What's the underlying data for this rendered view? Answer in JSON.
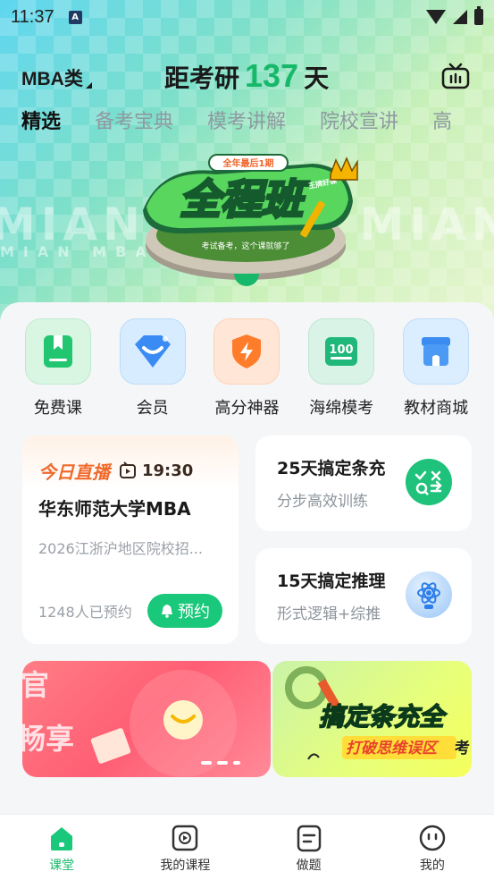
{
  "status": {
    "time": "11:37",
    "badge": "A"
  },
  "header": {
    "category": "MBA类",
    "countdown_prefix": "距考研",
    "countdown_days": "137",
    "countdown_suffix": "天"
  },
  "tabs": [
    {
      "label": "精选",
      "active": true
    },
    {
      "label": "备考宝典",
      "active": false
    },
    {
      "label": "模考讲解",
      "active": false
    },
    {
      "label": "院校宣讲",
      "active": false
    },
    {
      "label": "高",
      "active": false
    }
  ],
  "banner": {
    "ribbon": "全年最后1期",
    "title": "全程班",
    "sub": "考试备考，这个课就够了",
    "crown": "王牌好课",
    "bg_text": "MIAN MBA · MIAN MBA",
    "bg_text2": "MIAN MBA      MIAN MBA"
  },
  "quick_links": [
    {
      "label": "免费课",
      "icon": "bookmark-book-icon",
      "bg": "#d9f6e3"
    },
    {
      "label": "会员",
      "icon": "vip-diamond-icon",
      "bg": "#d7ecff"
    },
    {
      "label": "高分神器",
      "icon": "lightning-shield-icon",
      "bg": "#ffe6d6"
    },
    {
      "label": "海绵模考",
      "icon": "score-100-icon",
      "bg": "#d9f3e6"
    },
    {
      "label": "教材商城",
      "icon": "store-icon",
      "bg": "#dbeeff"
    }
  ],
  "live": {
    "tag": "今日直播",
    "time": "19:30",
    "title": "华东师范大学MBA",
    "subtitle": "2026江浙沪地区院校招...",
    "count": "1248人已预约",
    "button": "预约"
  },
  "mini_cards": [
    {
      "title": "25天搞定条充",
      "sub": "分步高效训练"
    },
    {
      "title": "15天搞定推理",
      "sub": "形式逻辑+综推"
    }
  ],
  "promo": {
    "left_text1": "官",
    "left_text2": "畅享",
    "right_text1": "搞定条充全",
    "right_text2": "打破思维误区",
    "right_text3": "考"
  },
  "bottom_nav": [
    {
      "label": "课堂",
      "icon": "home-icon",
      "active": true
    },
    {
      "label": "我的课程",
      "icon": "play-course-icon",
      "active": false
    },
    {
      "label": "做题",
      "icon": "exercise-doc-icon",
      "active": false
    },
    {
      "label": "我的",
      "icon": "profile-face-icon",
      "active": false
    }
  ]
}
